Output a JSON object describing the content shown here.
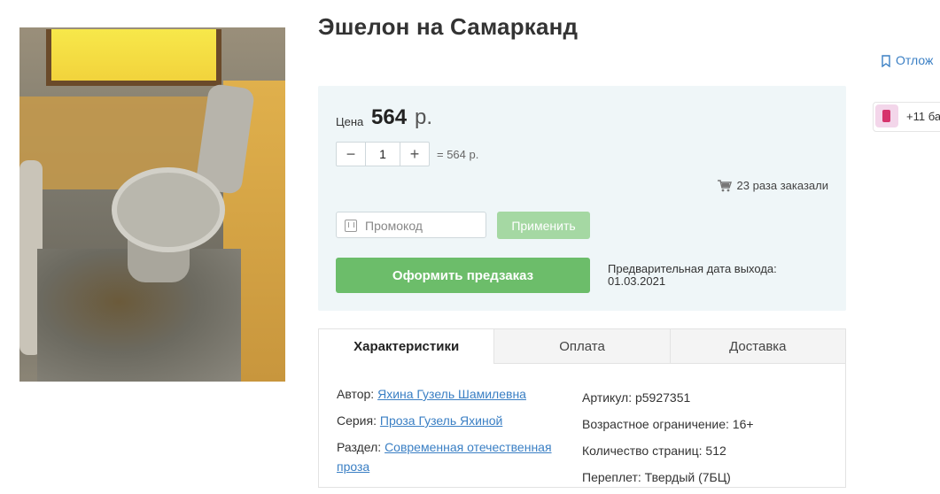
{
  "product": {
    "title": "Эшелон на Самарканд"
  },
  "actions": {
    "bookmark_label": "Отлож",
    "bonus_text": "+11 ба"
  },
  "buy": {
    "price_label": "Цена",
    "price_value": "564",
    "price_currency": "р.",
    "qty_minus": "−",
    "qty_value": "1",
    "qty_plus": "+",
    "total": "= 564 р.",
    "ordered_count": "23 раза заказали",
    "promo_placeholder": "Промокод",
    "apply_label": "Применить",
    "preorder_label": "Оформить предзаказ",
    "release_label": "Предварительная дата выхода:",
    "release_date": "01.03.2021"
  },
  "tabs": [
    {
      "label": "Характеристики",
      "active": true
    },
    {
      "label": "Оплата",
      "active": false
    },
    {
      "label": "Доставка",
      "active": false
    }
  ],
  "specs": {
    "author_label": "Автор:",
    "author_value": "Яхина Гузель Шамилевна",
    "series_label": "Серия:",
    "series_value": "Проза Гузель Яхиной",
    "section_label": "Раздел:",
    "section_value": "Современная отечественная проза",
    "article": "Артикул: p5927351",
    "age": "Возрастное ограничение: 16+",
    "pages": "Количество страниц: 512",
    "binding": "Переплет: Твердый (7БЦ)"
  },
  "colors": {
    "accent_green": "#6cbd6a",
    "apply_green_disabled": "#a5d8a3",
    "link_blue": "#3a7fc4",
    "buybox_bg": "#eff6f8"
  },
  "icons": [
    "bookmark-icon",
    "bonus-icon",
    "cart-icon",
    "promo-icon"
  ]
}
